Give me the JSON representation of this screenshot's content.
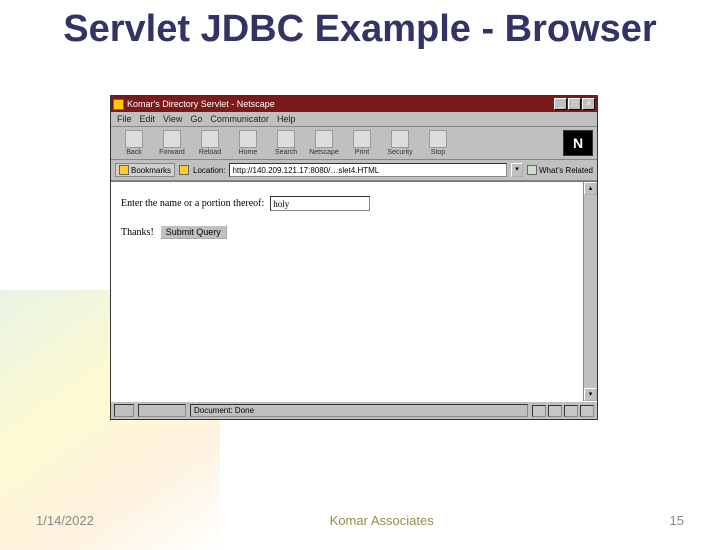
{
  "slide": {
    "title": "Servlet JDBC Example - Browser"
  },
  "browser": {
    "title": "Komar's Directory Servlet - Netscape",
    "menus": [
      "File",
      "Edit",
      "View",
      "Go",
      "Communicator",
      "Help"
    ],
    "toolbar": {
      "back": "Back",
      "forward": "Forward",
      "reload": "Reload",
      "home": "Home",
      "search": "Search",
      "netscape": "Netscape",
      "print": "Print",
      "security": "Security",
      "stop": "Stop"
    },
    "bookmarks_label": "Bookmarks",
    "location_label": "Location:",
    "location_value": "http://140.209.121.17:8080/…slet4.HTML",
    "related_label": "What's Related",
    "status": "Document: Done"
  },
  "page": {
    "prompt": "Enter the name or a portion thereof:",
    "input_value": "holy",
    "thanks": "Thanks!",
    "submit_label": "Submit Query"
  },
  "footer": {
    "date": "1/14/2022",
    "org": "Komar Associates",
    "pagenum": "15"
  }
}
